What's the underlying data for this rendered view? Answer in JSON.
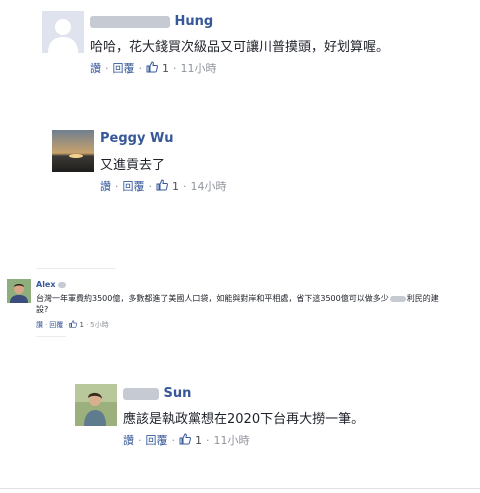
{
  "comments": [
    {
      "name": "Hung",
      "text": "哈哈，花大錢買次級品又可讓川普摸頭，好划算喔。",
      "like_label": "讚",
      "reply_label": "回覆",
      "like_count": "1",
      "time": "11小時"
    },
    {
      "name": "Peggy Wu",
      "text": "又進貢去了",
      "like_label": "讚",
      "reply_label": "回覆",
      "like_count": "1",
      "time": "14小時"
    },
    {
      "name": "Alex",
      "text_line1": "台灣一年軍費約3500億，多數都進了美國人口袋，如能與對岸和平相處，省下這3500億可以做多少",
      "text_line1_end": "利民的建",
      "text_line2": "設?",
      "like_label": "讚",
      "reply_label": "回覆",
      "like_count": "1",
      "time": "5小時"
    },
    {
      "name": "Sun",
      "text": "應該是執政黨想在2020下台再大撈一筆。",
      "like_label": "讚",
      "reply_label": "回覆",
      "like_count": "1",
      "time": "11小時"
    }
  ],
  "colors": {
    "link": "#365899",
    "meta": "#90949c",
    "text": "#1d2129"
  },
  "icons": [
    "default-avatar-icon",
    "sunset-avatar-icon",
    "alex-avatar-icon",
    "sun-avatar-icon",
    "like-icon"
  ]
}
